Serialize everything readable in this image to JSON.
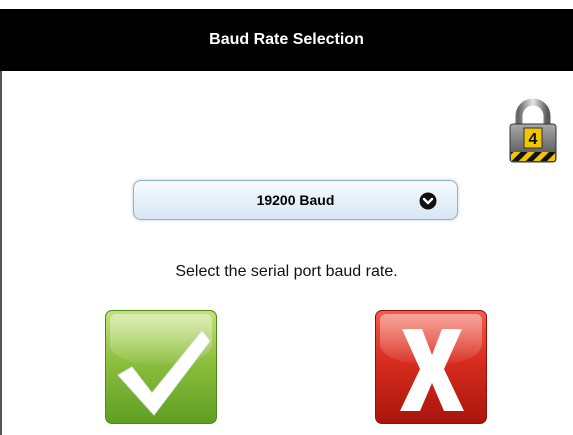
{
  "window": {
    "title": "Baud Rate Selection"
  },
  "lock": {
    "icon": "padlock-icon",
    "level": "4"
  },
  "baud": {
    "selected": "19200 Baud",
    "icon": "chevron-down-icon"
  },
  "description": "Select the serial port baud rate.",
  "buttons": {
    "confirm": {
      "icon": "checkmark-icon",
      "color": "#8cbf3d"
    },
    "cancel": {
      "icon": "x-icon",
      "color": "#d62c1e"
    }
  }
}
